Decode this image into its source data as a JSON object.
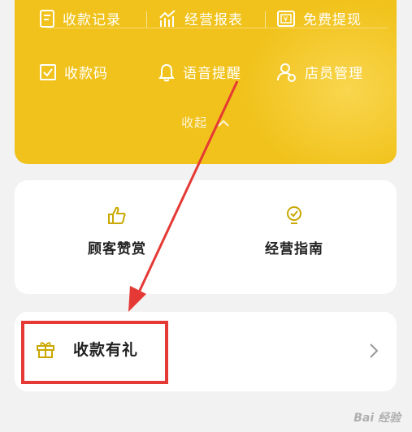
{
  "top_menu": {
    "row1": [
      {
        "label": "收款记录",
        "icon": "receipt-icon"
      },
      {
        "label": "经营报表",
        "icon": "growth-chart-icon"
      },
      {
        "label": "免费提现",
        "icon": "yuan-withdraw-icon"
      }
    ],
    "row2": [
      {
        "label": "收款码",
        "icon": "qr-check-icon"
      },
      {
        "label": "语音提醒",
        "icon": "bell-icon"
      },
      {
        "label": "店员管理",
        "icon": "staff-icon"
      }
    ],
    "collapse_label": "收起"
  },
  "features": [
    {
      "label": "顾客赞赏",
      "icon": "thumbs-up-icon"
    },
    {
      "label": "经营指南",
      "icon": "guide-icon"
    }
  ],
  "gift": {
    "label": "收款有礼",
    "icon": "gift-icon"
  },
  "watermark": "Bai 经验",
  "colors": {
    "brand_yellow": "#f1c21b",
    "annotation_red": "#e53935"
  }
}
